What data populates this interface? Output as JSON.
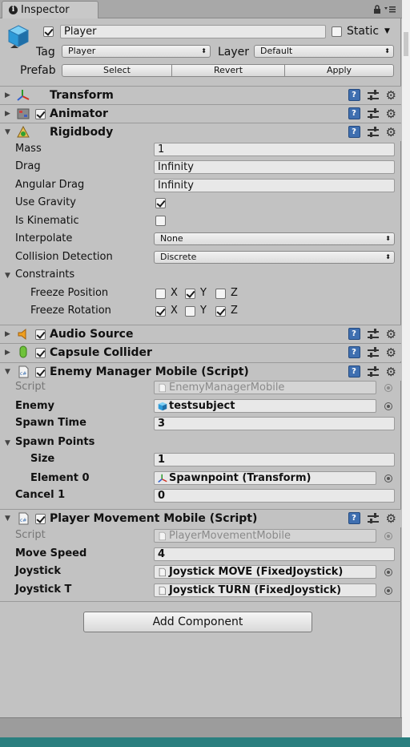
{
  "tab": {
    "title": "Inspector"
  },
  "header": {
    "object_name": "Player",
    "active_checked": true,
    "static_label": "Static",
    "tag_label": "Tag",
    "tag_value": "Player",
    "layer_label": "Layer",
    "layer_value": "Default",
    "prefab_label": "Prefab",
    "prefab_buttons": [
      "Select",
      "Revert",
      "Apply"
    ]
  },
  "components": {
    "transform": {
      "title": "Transform"
    },
    "animator": {
      "title": "Animator",
      "enabled": true
    },
    "rigidbody": {
      "title": "Rigidbody",
      "mass_label": "Mass",
      "mass": "1",
      "drag_label": "Drag",
      "drag": "Infinity",
      "angular_drag_label": "Angular Drag",
      "angular_drag": "Infinity",
      "use_gravity_label": "Use Gravity",
      "use_gravity": true,
      "is_kinematic_label": "Is Kinematic",
      "is_kinematic": false,
      "interpolate_label": "Interpolate",
      "interpolate": "None",
      "collision_label": "Collision Detection",
      "collision": "Discrete",
      "constraints_label": "Constraints",
      "freeze_position_label": "Freeze Position",
      "freeze_rotation_label": "Freeze Rotation",
      "axis_x": "X",
      "axis_y": "Y",
      "axis_z": "Z"
    },
    "audio_source": {
      "title": "Audio Source",
      "enabled": true
    },
    "capsule_collider": {
      "title": "Capsule Collider",
      "enabled": true
    },
    "enemy_manager": {
      "title": "Enemy Manager Mobile (Script)",
      "script_label": "Script",
      "script": "EnemyManagerMobile",
      "enemy_label": "Enemy",
      "enemy": "testsubject",
      "spawn_time_label": "Spawn Time",
      "spawn_time": "3",
      "spawn_points_label": "Spawn Points",
      "size_label": "Size",
      "size": "1",
      "element0_label": "Element 0",
      "element0": "Spawnpoint (Transform)",
      "cancel_label": "Cancel 1",
      "cancel": "0"
    },
    "player_movement": {
      "title": "Player Movement Mobile (Script)",
      "script_label": "Script",
      "script": "PlayerMovementMobile",
      "move_speed_label": "Move Speed",
      "move_speed": "4",
      "joystick_label": "Joystick",
      "joystick": "Joystick MOVE (FixedJoystick)",
      "joystick_t_label": "Joystick T",
      "joystick_t": "Joystick TURN (FixedJoystick)"
    }
  },
  "add_component_label": "Add Component",
  "icons": {
    "info": "info-icon",
    "lock": "lock-icon",
    "menu": "menu-icon",
    "help": "help-icon",
    "preset": "preset-icon",
    "gear": "gear-icon",
    "object_picker": "object-picker-icon"
  },
  "colors": {
    "panel": "#c2c2c2",
    "help_blue": "#3f6fb0",
    "bottom_strip": "#2a7f7f"
  }
}
